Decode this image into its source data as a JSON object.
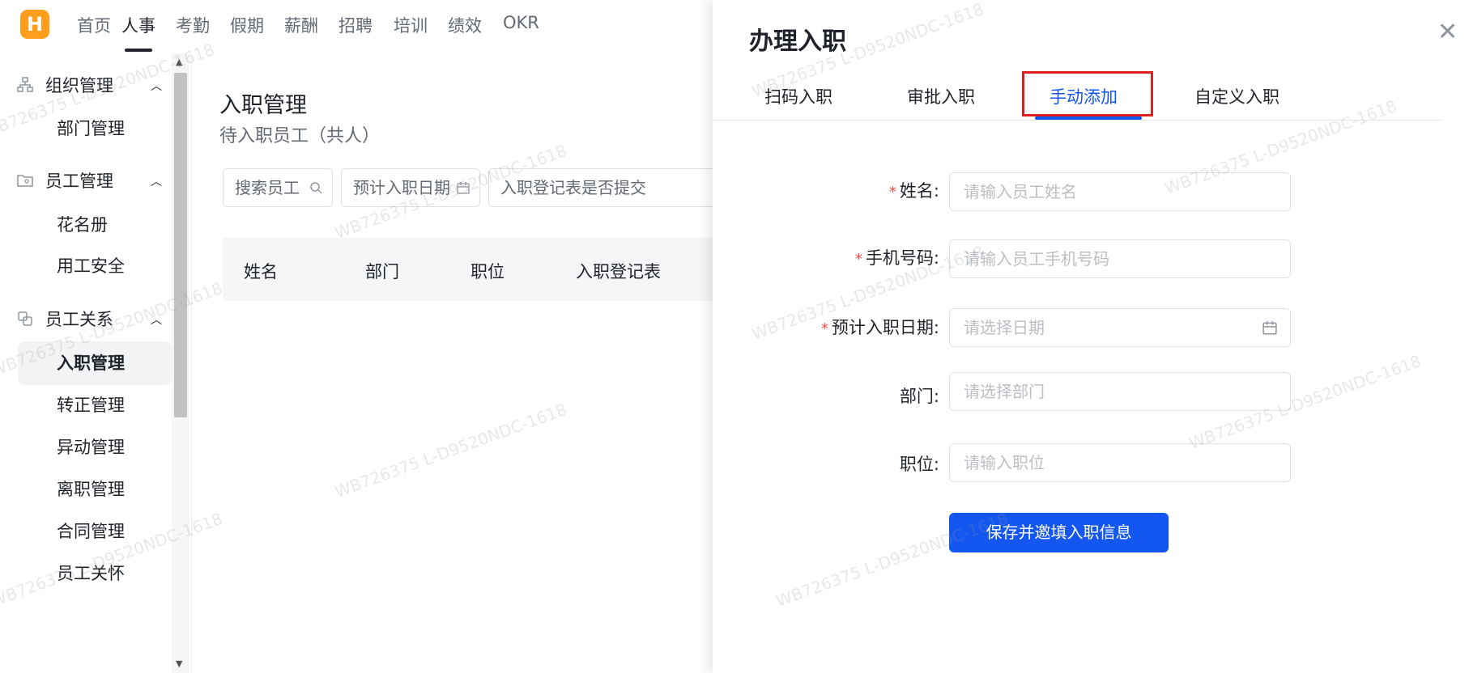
{
  "topnav": {
    "logo": "H",
    "items": [
      "首页",
      "人事",
      "考勤",
      "假期",
      "薪酬",
      "招聘",
      "培训",
      "绩效",
      "OKR"
    ],
    "active_index": 1
  },
  "sidebar": {
    "groups": [
      {
        "label": "组织管理",
        "icon": "org-chart-icon",
        "items": [
          "部门管理"
        ]
      },
      {
        "label": "员工管理",
        "icon": "employee-folder-icon",
        "items": [
          "花名册",
          "用工安全"
        ]
      },
      {
        "label": "员工关系",
        "icon": "relation-icon",
        "items": [
          "入职管理",
          "转正管理",
          "异动管理",
          "离职管理",
          "合同管理",
          "员工关怀"
        ]
      }
    ],
    "active_item": "入职管理"
  },
  "main": {
    "title": "入职管理",
    "subtitle": "待入职员工（共人）",
    "filters": {
      "search_placeholder": "搜索员工",
      "date_placeholder": "预计入职日期",
      "form_submitted_placeholder": "入职登记表是否提交"
    },
    "table_headers": [
      "姓名",
      "部门",
      "职位",
      "入职登记表"
    ]
  },
  "panel": {
    "title": "办理入职",
    "tabs": [
      "扫码入职",
      "审批入职",
      "手动添加",
      "自定义入职"
    ],
    "active_tab_index": 2,
    "fields": [
      {
        "label": "姓名:",
        "required": true,
        "placeholder": "请输入员工姓名",
        "icon": ""
      },
      {
        "label": "手机号码:",
        "required": true,
        "placeholder": "请输入员工手机号码",
        "icon": ""
      },
      {
        "label": "预计入职日期:",
        "required": true,
        "placeholder": "请选择日期",
        "icon": "calendar-icon"
      },
      {
        "label": "部门:",
        "required": false,
        "placeholder": "请选择部门",
        "icon": ""
      },
      {
        "label": "职位:",
        "required": false,
        "placeholder": "请输入职位",
        "icon": ""
      }
    ],
    "submit_label": "保存并邀填入职信息"
  },
  "watermark_text": "WB726375 L-D9520NDC-1618",
  "colors": {
    "accent": "#1456f0",
    "logo": "#ff9d1c",
    "required": "#f54a45",
    "highlight": "#e02020"
  }
}
